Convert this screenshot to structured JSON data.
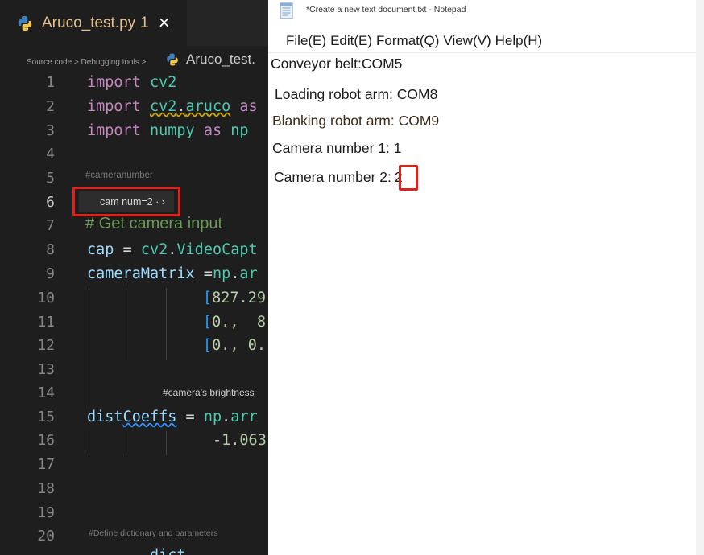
{
  "editor": {
    "tab": {
      "title": "Aruco_test.py",
      "badge": "1",
      "close": "×"
    },
    "breadcrumb": "Source code > Debugging tools >",
    "second_file": "Aruco_test.",
    "small_comments": {
      "cameranumber": "#cameranumber",
      "brightness": "#camera's brightness",
      "define_dict": "#Define dictionary and parameters"
    },
    "cam_hint": "cam num=2 · ›",
    "big_comment": "# Get camera input",
    "lines": [
      {
        "n": "1"
      },
      {
        "n": "2"
      },
      {
        "n": "3"
      },
      {
        "n": "4"
      },
      {
        "n": "5"
      },
      {
        "n": "6"
      },
      {
        "n": "7"
      },
      {
        "n": "8"
      },
      {
        "n": "9"
      },
      {
        "n": "10"
      },
      {
        "n": "11"
      },
      {
        "n": "12"
      },
      {
        "n": "13"
      },
      {
        "n": "14"
      },
      {
        "n": "15"
      },
      {
        "n": "16"
      },
      {
        "n": "17"
      },
      {
        "n": "18"
      },
      {
        "n": "19"
      },
      {
        "n": "20"
      }
    ],
    "code": {
      "l1": {
        "kw": "import",
        "mod": "cv2"
      },
      "l2": {
        "kw": "import",
        "mod1": "cv2",
        "dot": ".",
        "mod2": "aruco",
        "as": "as"
      },
      "l3": {
        "kw": "import",
        "mod": "numpy",
        "as": "as",
        "alias": "np"
      },
      "l8": {
        "var": "cap",
        "op": " = ",
        "mod": "cv2",
        "dot": ".",
        "fn": "VideoCapt"
      },
      "l9": {
        "var": "cameraMatrix",
        "op": " =",
        "mod": "np",
        "dot": ".",
        "fn": "ar"
      },
      "l10": {
        "br": "[",
        "num": "827.29"
      },
      "l11": {
        "br": "[",
        "num": "0.,  8"
      },
      "l12": {
        "br": "[",
        "num": "0., 0."
      },
      "l15": {
        "var1": "dist",
        "var2": "Coeffs",
        "op": " = ",
        "mod": "np",
        "dot": ".",
        "fn": "arr"
      },
      "l16": {
        "num": "-1.063"
      },
      "l21": {
        "partial": "dict"
      }
    }
  },
  "notepad": {
    "title": "*Create a new text document.txt - Notepad",
    "menu": [
      "File(E)",
      "Edit(E)",
      "Format(Q)",
      "View(V)",
      "Help(H)"
    ],
    "lines": [
      "Conveyor belt:COM5",
      "Loading robot arm: COM8",
      "Blanking robot arm: COM9",
      "Camera number 1: 1"
    ],
    "cam2_label": "Camera number 2:",
    "cam2_value": "2"
  },
  "colors": {
    "editor_bg": "#1e1e1e",
    "keyword": "#c586c0",
    "module": "#4ec9b0",
    "variable": "#9cdcfe",
    "number": "#b5cea8",
    "bracket": "#179fff",
    "comment": "#6a9955",
    "highlight_box": "#e0201a",
    "tab_title": "#e2c08d"
  },
  "icons": {
    "python": "python-logo-icon",
    "close": "close-icon",
    "notepad": "notepad-icon"
  }
}
